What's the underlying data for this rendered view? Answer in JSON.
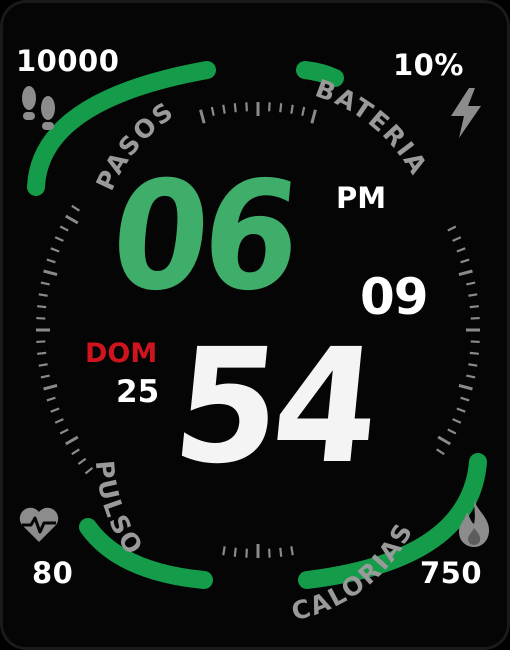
{
  "watch_face": {
    "steps": {
      "value": "10000",
      "label": "PASOS",
      "icon": "footprints-icon",
      "progress": 0.75
    },
    "battery": {
      "value": "10%",
      "label": "BATERIA",
      "icon": "lightning-bolt-icon",
      "progress": 0.1
    },
    "pulse": {
      "value": "80",
      "label": "PULSO",
      "icon": "heart-pulse-icon",
      "progress": 0.35
    },
    "calories": {
      "value": "750",
      "label": "CALORIAS",
      "icon": "flame-icon",
      "progress": 0.75
    },
    "time": {
      "hour": "06",
      "minute": "54",
      "second": "09",
      "ampm": "PM"
    },
    "date": {
      "weekday": "DOM",
      "day": "25"
    }
  },
  "colors": {
    "accent": "#159c4a",
    "hour": "#3fae6a",
    "minute": "#f4f4f4",
    "weekday": "#d0141e",
    "ticks": "#8a8a8a",
    "label": "#9a9a9a",
    "icon": "#8c8c8c"
  }
}
